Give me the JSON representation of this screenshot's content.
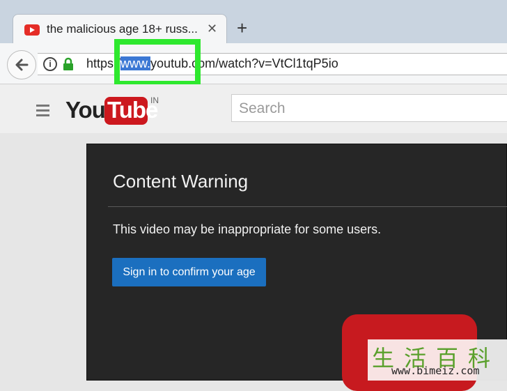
{
  "browser": {
    "tab": {
      "title": "the malicious age 18+ russ...",
      "close": "✕"
    },
    "new_tab": "+",
    "address": {
      "prefix": "https:/",
      "selected": "www.",
      "middle": "youtub",
      "suffix": ".com/watch?v=VtCl1tqP5io"
    },
    "info": "i"
  },
  "youtube": {
    "logo": {
      "you": "You",
      "tube": "Tube",
      "region": "IN"
    },
    "search": {
      "placeholder": "Search"
    }
  },
  "warning": {
    "title": "Content Warning",
    "message": "This video may be inappropriate for some users.",
    "button": "Sign in to confirm your age"
  },
  "watermark": {
    "chars": "生活百科",
    "url": "www.bimeiz.com"
  },
  "colors": {
    "highlight": "#2ee82e",
    "yt_red": "#cc181e",
    "button_blue": "#1b6fbf"
  }
}
